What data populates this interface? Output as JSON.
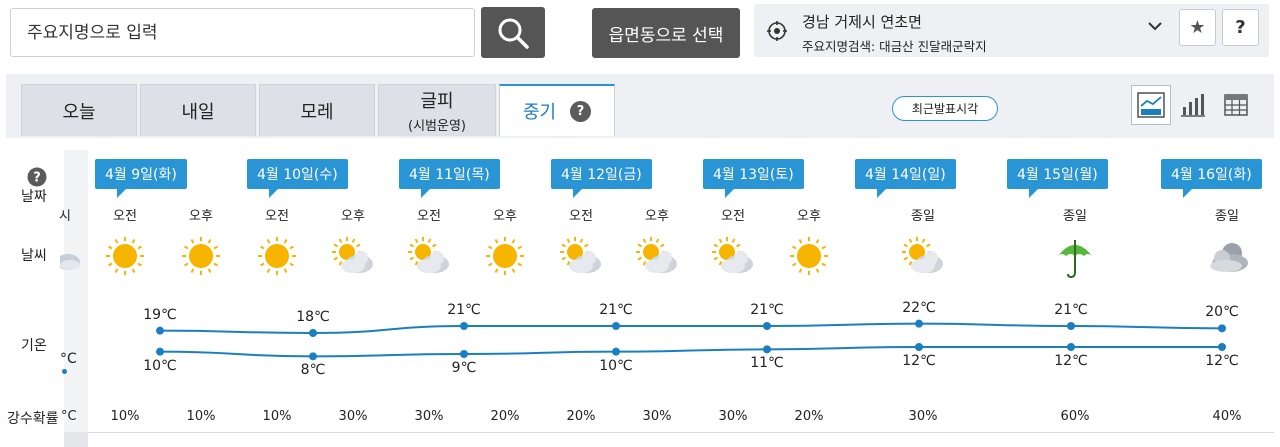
{
  "search": {
    "placeholder": "주요지명으로 입력"
  },
  "select_button": "읍면동으로 선택",
  "location": {
    "name": "경남 거제시 연초면",
    "sub": "주요지명검색: 대금산 진달래군락지"
  },
  "buttons": {
    "star": "★",
    "help": "?"
  },
  "tabs": [
    {
      "label": "오늘",
      "sub": ""
    },
    {
      "label": "내일",
      "sub": ""
    },
    {
      "label": "모레",
      "sub": ""
    },
    {
      "label": "글피",
      "sub": "(시범운영)"
    },
    {
      "label": "중기",
      "sub": ""
    }
  ],
  "recent_button": "최근발표시각",
  "row_labels": {
    "date": "날짜",
    "weather": "날씨",
    "temp": "기온",
    "rain": "강수확률"
  },
  "partial": {
    "time": "시",
    "temp": "°C",
    "rain": "°C"
  },
  "help_mark": "?",
  "days": [
    {
      "date": "4월 9일(화)"
    },
    {
      "date": "4월 10일(수)"
    },
    {
      "date": "4월 11일(목)"
    },
    {
      "date": "4월 12일(금)"
    },
    {
      "date": "4월 13일(토)"
    },
    {
      "date": "4월 14일(일)"
    },
    {
      "date": "4월 15일(월)"
    },
    {
      "date": "4월 16일(화)"
    }
  ],
  "periods": [
    {
      "label": "오전",
      "icon": "sun-icon",
      "rain": "10%"
    },
    {
      "label": "오후",
      "icon": "sun-icon",
      "rain": "10%"
    },
    {
      "label": "오전",
      "icon": "sun-icon",
      "rain": "10%"
    },
    {
      "label": "오후",
      "icon": "partly-cloudy-icon",
      "rain": "30%"
    },
    {
      "label": "오전",
      "icon": "partly-cloudy-icon",
      "rain": "30%"
    },
    {
      "label": "오후",
      "icon": "sun-icon",
      "rain": "20%"
    },
    {
      "label": "오전",
      "icon": "partly-cloudy-icon",
      "rain": "20%"
    },
    {
      "label": "오후",
      "icon": "partly-cloudy-icon",
      "rain": "30%"
    },
    {
      "label": "오전",
      "icon": "partly-cloudy-icon",
      "rain": "30%"
    },
    {
      "label": "오후",
      "icon": "sun-icon",
      "rain": "20%"
    },
    {
      "label": "종일",
      "icon": "partly-cloudy-icon",
      "rain": "30%"
    },
    {
      "label": "종일",
      "icon": "umbrella-icon",
      "rain": "60%"
    },
    {
      "label": "종일",
      "icon": "cloudy-icon",
      "rain": "40%"
    }
  ],
  "temps": {
    "max": [
      "19℃",
      "18℃",
      "21℃",
      "21℃",
      "21℃",
      "22℃",
      "21℃",
      "20℃"
    ],
    "min": [
      "10℃",
      "8℃",
      "9℃",
      "10℃",
      "11℃",
      "12℃",
      "12℃",
      "12℃"
    ]
  },
  "chart_data": {
    "type": "line",
    "categories": [
      "4월 9일(화)",
      "4월 10일(수)",
      "4월 11일(목)",
      "4월 12일(금)",
      "4월 13일(토)",
      "4월 14일(일)",
      "4월 15일(월)",
      "4월 16일(화)"
    ],
    "series": [
      {
        "values": [
          19,
          18,
          21,
          21,
          21,
          22,
          21,
          20
        ]
      },
      {
        "values": [
          10,
          8,
          9,
          10,
          11,
          12,
          12,
          12
        ]
      }
    ],
    "line_color": "#1a7fc2"
  },
  "colors": {
    "accent": "#2a95d4",
    "button_dark": "#555555",
    "tab_bg": "#dde1e7"
  }
}
